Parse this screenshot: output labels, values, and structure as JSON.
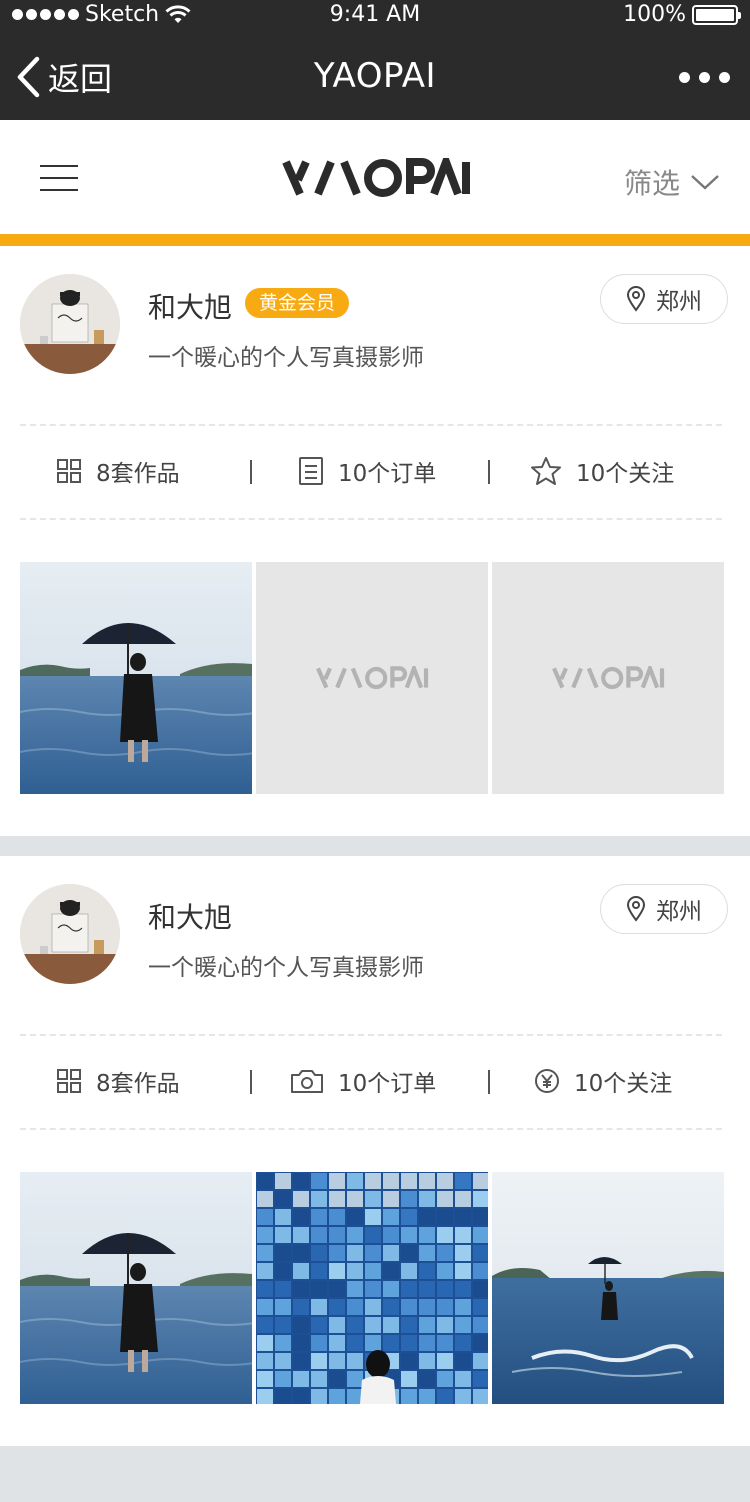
{
  "status_bar": {
    "carrier": "Sketch",
    "time": "9:41 AM",
    "battery": "100%",
    "battery_level": 1.0
  },
  "nav": {
    "back_label": "返回",
    "title": "YAOPAI"
  },
  "header": {
    "filter_label": "筛选"
  },
  "logo_text": "YAOPAI",
  "colors": {
    "accent": "#f8aa12",
    "nav_bg": "#2b2b2b"
  },
  "cards": [
    {
      "name": "和大旭",
      "badge": "黄金会员",
      "description": "一个暖心的个人写真摄影师",
      "location": "郑州",
      "stats": [
        {
          "icon": "grid-icon",
          "label": "8套作品"
        },
        {
          "icon": "list-icon",
          "label": "10个订单"
        },
        {
          "icon": "star-icon",
          "label": "10个关注"
        }
      ],
      "photos": [
        "umbrella-sea-photo",
        "yaopai-placeholder",
        "yaopai-placeholder"
      ]
    },
    {
      "name": "和大旭",
      "description": "一个暖心的个人写真摄影师",
      "location": "郑州",
      "stats": [
        {
          "icon": "grid-icon",
          "label": "8套作品"
        },
        {
          "icon": "camera-icon",
          "label": "10个订单"
        },
        {
          "icon": "yen-icon",
          "label": "10个关注"
        }
      ],
      "photos": [
        "umbrella-sea-photo",
        "blue-tiles-photo",
        "umbrella-sea-distant-photo"
      ]
    }
  ]
}
